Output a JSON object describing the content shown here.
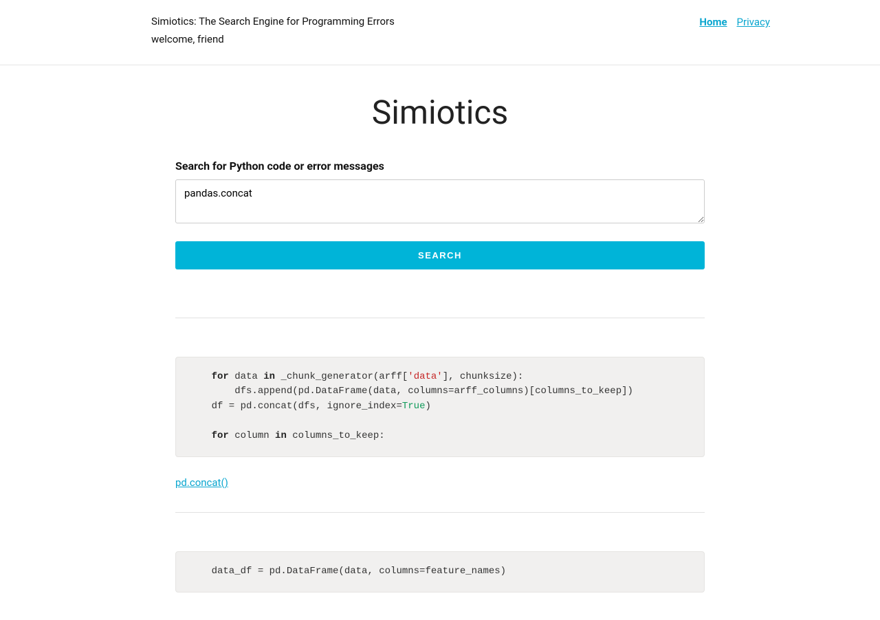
{
  "header": {
    "tagline": "Simiotics: The Search Engine for Programming Errors",
    "welcome": "welcome, friend",
    "nav": {
      "home": "Home",
      "privacy": "Privacy"
    }
  },
  "page": {
    "title": "Simiotics"
  },
  "search": {
    "label": "Search for Python code or error messages",
    "value": "pandas.concat",
    "button": "Search"
  },
  "results": [
    {
      "link_text": "pd.concat()",
      "code": {
        "tokens": [
          {
            "t": "    "
          },
          {
            "t": "for",
            "cls": "kw-bold"
          },
          {
            "t": " data "
          },
          {
            "t": "in",
            "cls": "kw-bold"
          },
          {
            "t": " _chunk_generator(arff["
          },
          {
            "t": "'data'",
            "cls": "kw-str"
          },
          {
            "t": "], chunksize):\n        dfs.append(pd.DataFrame(data, columns=arff_columns)[columns_to_keep])\n    df = pd.concat(dfs, ignore_index="
          },
          {
            "t": "True",
            "cls": "kw-bool"
          },
          {
            "t": ")\n\n    "
          },
          {
            "t": "for",
            "cls": "kw-bold"
          },
          {
            "t": " column "
          },
          {
            "t": "in",
            "cls": "kw-bold"
          },
          {
            "t": " columns_to_keep:"
          }
        ]
      }
    },
    {
      "link_text": "",
      "code": {
        "tokens": [
          {
            "t": "    data_df = pd.DataFrame(data, columns=feature_names)"
          }
        ]
      }
    }
  ]
}
